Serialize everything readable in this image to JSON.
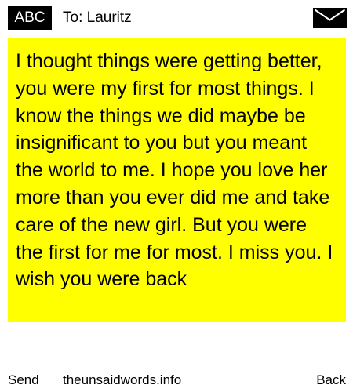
{
  "header": {
    "badge_label": "ABC",
    "recipient": "To: Lauritz",
    "envelope_icon": "envelope-icon"
  },
  "message": {
    "text": "I thought things were getting better, you were my first for most things. I know the things we did maybe be insignificant to you but you meant the world to me. I hope you love her more than you ever did me and take care of the new girl. But you were the first for me for most. I miss you. I wish you were back",
    "background_color": "#ffff00"
  },
  "footer": {
    "send_label": "Send",
    "site_label": "theunsaidwords.info",
    "back_label": "Back"
  }
}
